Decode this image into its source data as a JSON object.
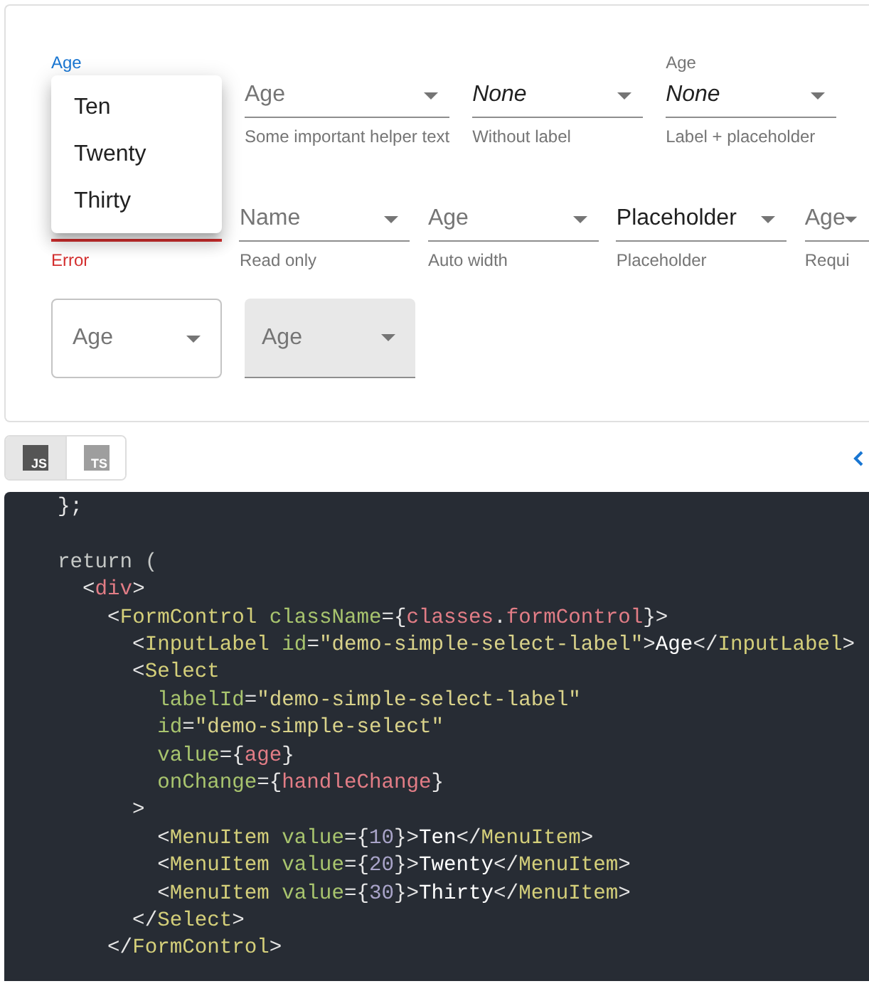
{
  "demo": {
    "rows": [
      {
        "controls": [
          {
            "kind": "standard",
            "label": "Age",
            "focused": true,
            "error": false,
            "menu": {
              "items": [
                {
                  "label": "Ten",
                  "selected": false
                },
                {
                  "label": "Twenty",
                  "selected": false
                },
                {
                  "label": "Thirty",
                  "selected": false
                }
              ]
            }
          },
          {
            "kind": "standard",
            "placeholder": "Age",
            "focused": false,
            "error": false,
            "helper": "Some important helper text"
          },
          {
            "kind": "emphasized",
            "value": "None",
            "focused": false,
            "error": false,
            "helper": "Without label"
          },
          {
            "kind": "emphasized",
            "label": "Age",
            "value": "None",
            "focused": false,
            "error": false,
            "helper": "Label + placeholder"
          }
        ]
      },
      {
        "controls": [
          {
            "kind": "standard",
            "focused": false,
            "error": true,
            "helper": "Error"
          },
          {
            "kind": "standard",
            "placeholder": "Name",
            "focused": false,
            "error": false,
            "helper": "Read only"
          },
          {
            "kind": "standard",
            "placeholder": "Age",
            "focused": false,
            "error": false,
            "helper": "Auto width"
          },
          {
            "kind": "standard",
            "value": "Placeholder",
            "focused": false,
            "error": false,
            "helper": "Placeholder"
          },
          {
            "kind": "standard",
            "placeholder": "Age",
            "focused": false,
            "error": false,
            "helper": "Requi"
          }
        ]
      },
      {
        "controls": [
          {
            "kind": "outlined",
            "placeholder": "Age",
            "focused": false,
            "error": false
          },
          {
            "kind": "filled",
            "placeholder": "Age",
            "focused": false,
            "error": false
          }
        ]
      }
    ]
  },
  "language_toggle": [
    {
      "label": "JS",
      "selected": true
    },
    {
      "label": "TS",
      "selected": false
    }
  ],
  "code": {
    "lines": [
      {
        "tokens": [
          {
            "kind": "punct",
            "text": "  };"
          }
        ]
      },
      {
        "blank_before": true,
        "tokens": [
          {
            "kind": "keyword",
            "text": "  return ("
          }
        ]
      },
      {
        "tokens": [
          {
            "kind": "punct",
            "text": "    <"
          },
          {
            "kind": "html",
            "text": "div"
          },
          {
            "kind": "punct",
            "text": ">"
          }
        ]
      },
      {
        "tokens": [
          {
            "kind": "punct",
            "text": "      <"
          },
          {
            "kind": "component",
            "text": "FormControl"
          },
          {
            "kind": "attr",
            "text": " className"
          },
          {
            "kind": "punct",
            "text": "={"
          },
          {
            "kind": "expr",
            "text": "classes"
          },
          {
            "kind": "punct",
            "text": "."
          },
          {
            "kind": "expr",
            "text": "formControl"
          },
          {
            "kind": "punct",
            "text": "}>"
          }
        ]
      },
      {
        "tokens": [
          {
            "kind": "punct",
            "text": "        <"
          },
          {
            "kind": "component",
            "text": "InputLabel"
          },
          {
            "kind": "attr",
            "text": " id"
          },
          {
            "kind": "punct",
            "text": "="
          },
          {
            "kind": "string",
            "text": "\"demo-simple-select-label\""
          },
          {
            "kind": "punct",
            "text": ">"
          },
          {
            "kind": "text",
            "text": "Age"
          },
          {
            "kind": "punct",
            "text": "</"
          },
          {
            "kind": "component",
            "text": "InputLabel"
          },
          {
            "kind": "punct",
            "text": ">"
          }
        ]
      },
      {
        "tokens": [
          {
            "kind": "punct",
            "text": "        <"
          },
          {
            "kind": "component",
            "text": "Select"
          }
        ]
      },
      {
        "tokens": [
          {
            "kind": "attr",
            "text": "          labelId"
          },
          {
            "kind": "punct",
            "text": "="
          },
          {
            "kind": "string",
            "text": "\"demo-simple-select-label\""
          }
        ]
      },
      {
        "tokens": [
          {
            "kind": "attr",
            "text": "          id"
          },
          {
            "kind": "punct",
            "text": "="
          },
          {
            "kind": "string",
            "text": "\"demo-simple-select\""
          }
        ]
      },
      {
        "tokens": [
          {
            "kind": "attr",
            "text": "          value"
          },
          {
            "kind": "punct",
            "text": "={"
          },
          {
            "kind": "expr",
            "text": "age"
          },
          {
            "kind": "punct",
            "text": "}"
          }
        ]
      },
      {
        "tokens": [
          {
            "kind": "attr",
            "text": "          onChange"
          },
          {
            "kind": "punct",
            "text": "={"
          },
          {
            "kind": "expr",
            "text": "handleChange"
          },
          {
            "kind": "punct",
            "text": "}"
          }
        ]
      },
      {
        "tokens": [
          {
            "kind": "punct",
            "text": "        >"
          }
        ]
      },
      {
        "tokens": [
          {
            "kind": "punct",
            "text": "          <"
          },
          {
            "kind": "component",
            "text": "MenuItem"
          },
          {
            "kind": "attr",
            "text": " value"
          },
          {
            "kind": "punct",
            "text": "={"
          },
          {
            "kind": "number",
            "text": "10"
          },
          {
            "kind": "punct",
            "text": "}>"
          },
          {
            "kind": "text",
            "text": "Ten"
          },
          {
            "kind": "punct",
            "text": "</"
          },
          {
            "kind": "component",
            "text": "MenuItem"
          },
          {
            "kind": "punct",
            "text": ">"
          }
        ]
      },
      {
        "tokens": [
          {
            "kind": "punct",
            "text": "          <"
          },
          {
            "kind": "component",
            "text": "MenuItem"
          },
          {
            "kind": "attr",
            "text": " value"
          },
          {
            "kind": "punct",
            "text": "={"
          },
          {
            "kind": "number",
            "text": "20"
          },
          {
            "kind": "punct",
            "text": "}>"
          },
          {
            "kind": "text",
            "text": "Twenty"
          },
          {
            "kind": "punct",
            "text": "</"
          },
          {
            "kind": "component",
            "text": "MenuItem"
          },
          {
            "kind": "punct",
            "text": ">"
          }
        ]
      },
      {
        "tokens": [
          {
            "kind": "punct",
            "text": "          <"
          },
          {
            "kind": "component",
            "text": "MenuItem"
          },
          {
            "kind": "attr",
            "text": " value"
          },
          {
            "kind": "punct",
            "text": "={"
          },
          {
            "kind": "number",
            "text": "30"
          },
          {
            "kind": "punct",
            "text": "}>"
          },
          {
            "kind": "text",
            "text": "Thirty"
          },
          {
            "kind": "punct",
            "text": "</"
          },
          {
            "kind": "component",
            "text": "MenuItem"
          },
          {
            "kind": "punct",
            "text": ">"
          }
        ]
      },
      {
        "tokens": [
          {
            "kind": "punct",
            "text": "        </"
          },
          {
            "kind": "component",
            "text": "Select"
          },
          {
            "kind": "punct",
            "text": ">"
          }
        ]
      },
      {
        "tokens": [
          {
            "kind": "punct",
            "text": "      </"
          },
          {
            "kind": "component",
            "text": "FormControl"
          },
          {
            "kind": "punct",
            "text": ">"
          }
        ]
      }
    ]
  }
}
